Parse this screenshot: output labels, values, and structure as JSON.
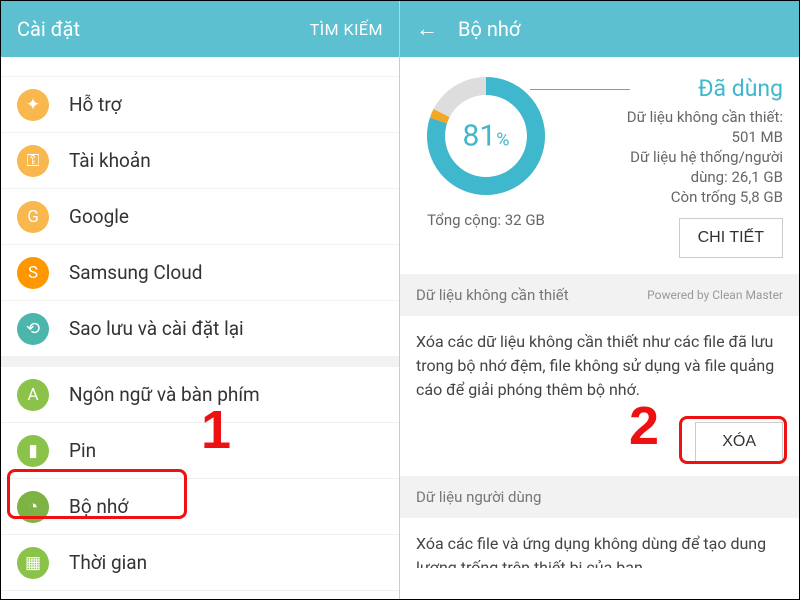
{
  "left": {
    "header_title": "Cài đặt",
    "header_search": "TÌM KIẾM",
    "items": [
      {
        "label": "Hỗ trợ",
        "icon": "accessibility-icon",
        "color": "orange",
        "glyph": "✦"
      },
      {
        "label": "Tài khoản",
        "icon": "key-icon",
        "color": "orange",
        "glyph": "⚿"
      },
      {
        "label": "Google",
        "icon": "google-icon",
        "color": "orange",
        "glyph": "G"
      },
      {
        "label": "Samsung Cloud",
        "icon": "cloud-icon",
        "color": "sorange",
        "glyph": "S"
      },
      {
        "label": "Sao lưu và cài đặt lại",
        "icon": "backup-icon",
        "color": "teal",
        "glyph": "⟲"
      },
      {
        "label": "Ngôn ngữ và bàn phím",
        "icon": "language-icon",
        "color": "green",
        "glyph": "A"
      },
      {
        "label": "Pin",
        "icon": "battery-icon",
        "color": "green",
        "glyph": "▮"
      },
      {
        "label": "Bộ nhớ",
        "icon": "storage-icon",
        "color": "green2",
        "glyph": "◔"
      },
      {
        "label": "Thời gian",
        "icon": "date-icon",
        "color": "green",
        "glyph": "▦"
      }
    ],
    "annotation": "1"
  },
  "right": {
    "header_title": "Bộ nhớ",
    "used_percent": "81",
    "used_percent_suffix": "%",
    "used_label": "Đã dùng",
    "junk_line1": "Dữ liệu không cần thiết:",
    "junk_line2": "501 MB",
    "sys_line1": "Dữ liệu hệ thống/người",
    "sys_line2": "dùng: 26,1 GB",
    "avail_line": "Còn trống 5,8 GB",
    "total_line": "Tổng cộng: 32 GB",
    "detail_btn": "CHI TIẾT",
    "section1_title": "Dữ liệu không cần thiết",
    "powered": "Powered by Clean Master",
    "section1_body": "Xóa các dữ liệu không cần thiết như các file đã lưu trong bộ nhớ đệm, file không sử dụng và file quảng cáo để giải phóng thêm bộ nhớ.",
    "delete_btn": "XÓA",
    "section2_title": "Dữ liệu người dùng",
    "section2_body": "Xóa các file và ứng dụng không dùng để tạo dung lượng trống trên thiết bị của bạn.",
    "annotation": "2"
  },
  "chart_data": {
    "type": "pie",
    "title": "Đã dùng",
    "categories": [
      "Dữ liệu hệ thống/người dùng",
      "Dữ liệu không cần thiết",
      "Còn trống"
    ],
    "values": [
      26.1,
      0.5,
      5.8
    ],
    "total_gb": 32,
    "used_percent": 81
  }
}
